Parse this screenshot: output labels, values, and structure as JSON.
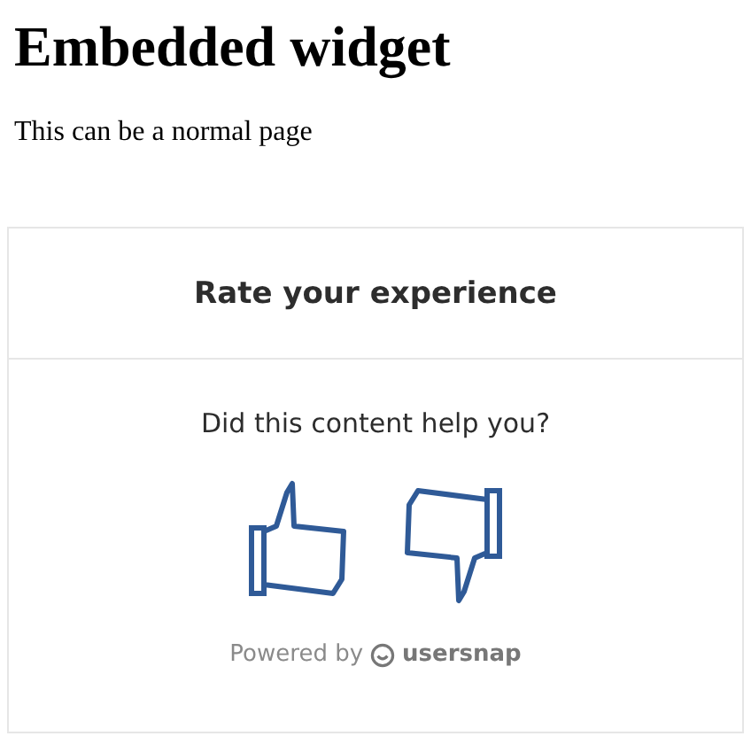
{
  "heading": "Embedded widget",
  "paragraph": "This can be a normal page",
  "widget": {
    "title": "Rate your experience",
    "question": "Did this content help you?",
    "options": [
      {
        "kind": "up"
      },
      {
        "kind": "down"
      }
    ],
    "footer": {
      "prefix": "Powered by",
      "brand": "usersnap"
    }
  }
}
